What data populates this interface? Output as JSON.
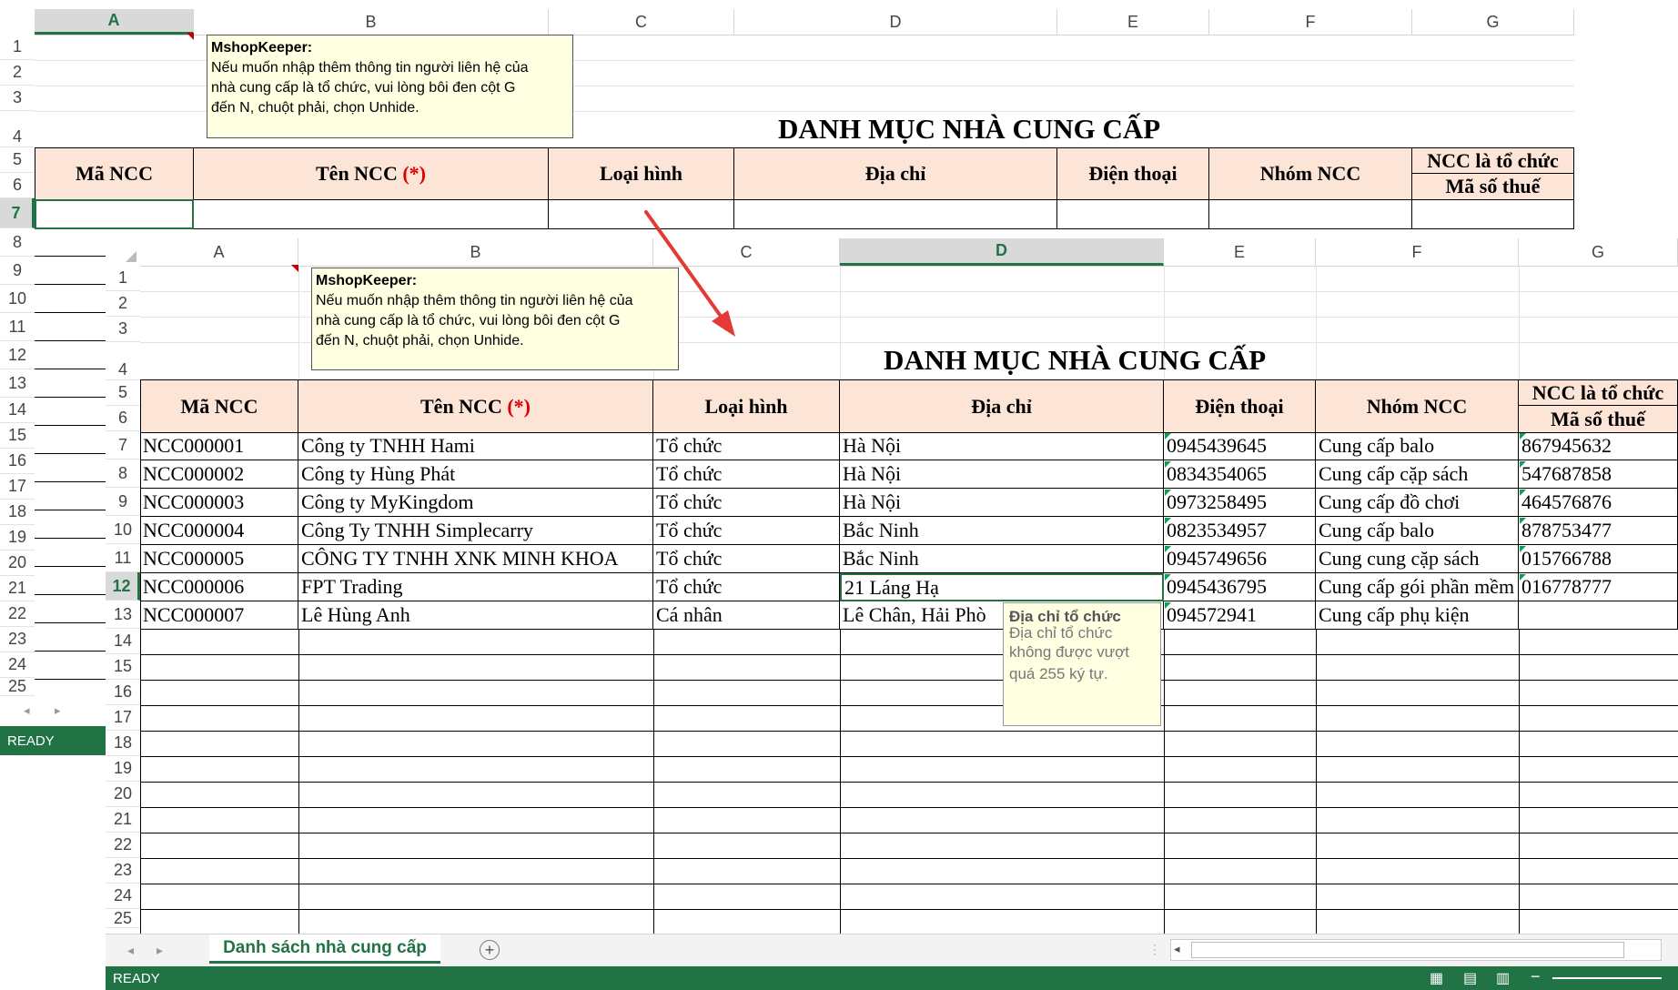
{
  "back_sheet": {
    "columns": [
      "A",
      "B",
      "C",
      "D",
      "E",
      "F",
      "G"
    ],
    "rows": [
      "1",
      "2",
      "3",
      "4",
      "5",
      "6",
      "7",
      "8",
      "9",
      "10",
      "11",
      "12",
      "13",
      "14",
      "15",
      "16",
      "17",
      "18",
      "19",
      "20",
      "21",
      "22",
      "23",
      "24",
      "25"
    ],
    "title": "DANH MỤC NHÀ CUNG CẤP",
    "status": "READY"
  },
  "front_sheet": {
    "columns": [
      "A",
      "B",
      "C",
      "D",
      "E",
      "F",
      "G"
    ],
    "rows": [
      "1",
      "2",
      "3",
      "4",
      "5",
      "6",
      "7",
      "8",
      "9",
      "10",
      "11",
      "12",
      "13",
      "14",
      "15",
      "16",
      "17",
      "18",
      "19",
      "20",
      "21",
      "22",
      "23",
      "24",
      "25"
    ],
    "title": "DANH MỤC NHÀ CUNG CẤP",
    "sheet_tab": "Danh sách nhà cung cấp",
    "status": "READY"
  },
  "comment": {
    "author": "MshopKeeper:",
    "lines": [
      "Nếu muốn nhập thêm thông tin người liên hệ của",
      "nhà cung cấp là tổ chức, vui lòng bôi đen cột G",
      "đến N, chuột phải, chọn Unhide."
    ]
  },
  "headers": {
    "ma": "Mã NCC",
    "ten": "Tên NCC",
    "ten_req": "(*)",
    "loai": "Loại hình",
    "diachi": "Địa chỉ",
    "dienthoai": "Điện thoại",
    "nhom": "Nhóm NCC",
    "tochuc": "NCC là tổ chức",
    "mst": "Mã số thuế"
  },
  "rows": [
    {
      "ma": "NCC000001",
      "ten": "Công ty TNHH Hami",
      "loai": "Tổ chức",
      "diachi": "Hà Nội",
      "dienthoai": "0945439645",
      "nhom": "Cung cấp balo",
      "mst": "867945632"
    },
    {
      "ma": "NCC000002",
      "ten": "Công ty Hùng Phát",
      "loai": "Tổ chức",
      "diachi": "Hà Nội",
      "dienthoai": "0834354065",
      "nhom": "Cung cấp cặp sách",
      "mst": "547687858"
    },
    {
      "ma": "NCC000003",
      "ten": "Công ty MyKingdom",
      "loai": "Tổ chức",
      "diachi": "Hà Nội",
      "dienthoai": "0973258495",
      "nhom": "Cung cấp đồ chơi",
      "mst": "464576876"
    },
    {
      "ma": "NCC000004",
      "ten": "Công Ty TNHH Simplecarry",
      "loai": "Tổ chức",
      "diachi": "Bắc Ninh",
      "dienthoai": "0823534957",
      "nhom": "Cung cấp balo",
      "mst": "878753477"
    },
    {
      "ma": "NCC000005",
      "ten": "CÔNG TY TNHH XNK MINH KHOA",
      "loai": "Tổ chức",
      "diachi": "Bắc Ninh",
      "dienthoai": "0945749656",
      "nhom": "Cung cung cặp sách",
      "mst": "015766788"
    },
    {
      "ma": "NCC000006",
      "ten": "FPT Trading",
      "loai": "Tổ chức",
      "diachi": "21 Láng Hạ",
      "dienthoai": "0945436795",
      "nhom": "Cung cấp gói phần mềm",
      "mst": "016778777"
    },
    {
      "ma": "NCC000007",
      "ten": "Lê Hùng Anh",
      "loai": "Cá nhân",
      "diachi": "Lê Chân, Hải Phò",
      "dienthoai": "094572941",
      "nhom": "Cung cấp phụ kiện",
      "mst": ""
    }
  ],
  "tooltip": {
    "title": "Địa chỉ tổ chức",
    "lines": [
      "Địa chỉ tổ chức",
      "không được vượt",
      "quá 255 ký tự."
    ]
  },
  "colors": {
    "excel_green": "#217346",
    "header_fill": "#fce4d6",
    "arrow": "#e53935"
  }
}
